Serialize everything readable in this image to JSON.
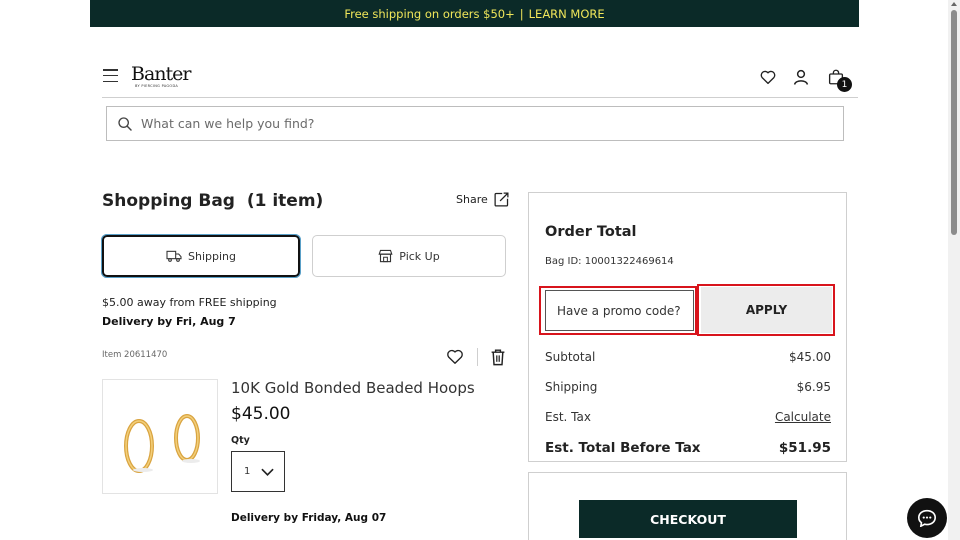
{
  "banner": {
    "text": "Free shipping on orders $50+",
    "separator": "|",
    "link": "LEARN MORE"
  },
  "header": {
    "logo": "Banter",
    "logo_sub": "BY PIERCING PAGODA",
    "icons": [
      "menu-icon",
      "heart-icon",
      "user-icon",
      "bag-icon"
    ],
    "cart_count": "1"
  },
  "search": {
    "placeholder": "What can we help you find?"
  },
  "bag": {
    "title": "Shopping Bag  (1 item)",
    "share": "Share",
    "tabs": {
      "shipping": "Shipping",
      "pickup": "Pick Up"
    },
    "free_shipping_msg": "$5.00 away from FREE shipping",
    "delivery_by": "Delivery by Fri, Aug 7",
    "item": {
      "number": "Item 20611470",
      "name": "10K Gold Bonded Beaded Hoops",
      "price": "$45.00",
      "qty_label": "Qty",
      "qty": "1",
      "delivery": "Delivery by Friday, Aug 07"
    }
  },
  "order": {
    "title": "Order Total",
    "bag_id": "Bag ID: 10001322469614",
    "promo_placeholder": "Have a promo code?",
    "apply": "APPLY",
    "subtotal_label": "Subtotal",
    "subtotal": "$45.00",
    "shipping_label": "Shipping",
    "shipping": "$6.95",
    "tax_label": "Est. Tax",
    "tax": "Calculate",
    "total_label": "Est. Total Before Tax",
    "total": "$51.95",
    "checkout": "CHECKOUT"
  },
  "colors": {
    "brand_dark": "#0b2a28",
    "banner_text": "#f0e65a",
    "highlight": "#d8141c"
  }
}
